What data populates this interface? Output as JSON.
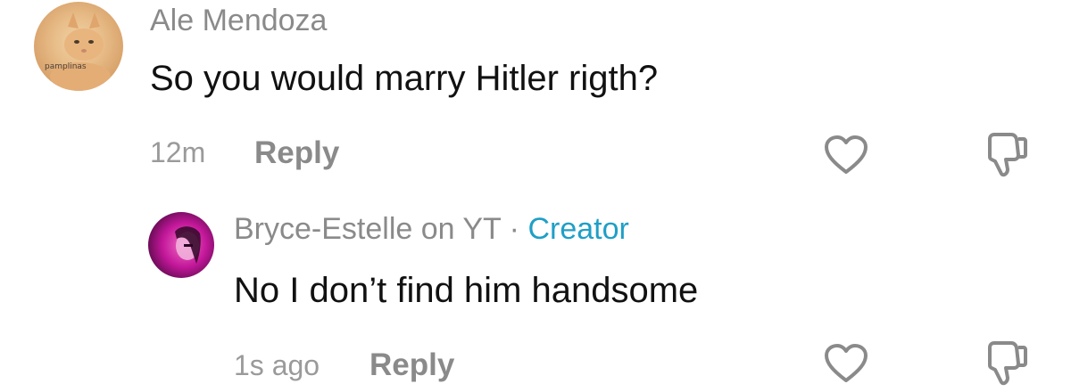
{
  "comments": [
    {
      "username": "Ale Mendoza",
      "avatar_label": "pamplinas",
      "text": "So you would marry Hitler rigth?",
      "time": "12m",
      "reply_label": "Reply",
      "like_icon": "heart-outline-icon",
      "dislike_icon": "thumbs-down-outline-icon"
    },
    {
      "username": "Bryce-Estelle on YT",
      "separator": "·",
      "badge": "Creator",
      "text": "No I don’t find him handsome",
      "time": "1s ago",
      "reply_label": "Reply",
      "like_icon": "heart-outline-icon",
      "dislike_icon": "thumbs-down-outline-icon"
    }
  ],
  "colors": {
    "username": "#8a8a8a",
    "text": "#111111",
    "meta": "#9a9a9a",
    "creator": "#1f9fc6",
    "icon": "#8a8a8a"
  }
}
